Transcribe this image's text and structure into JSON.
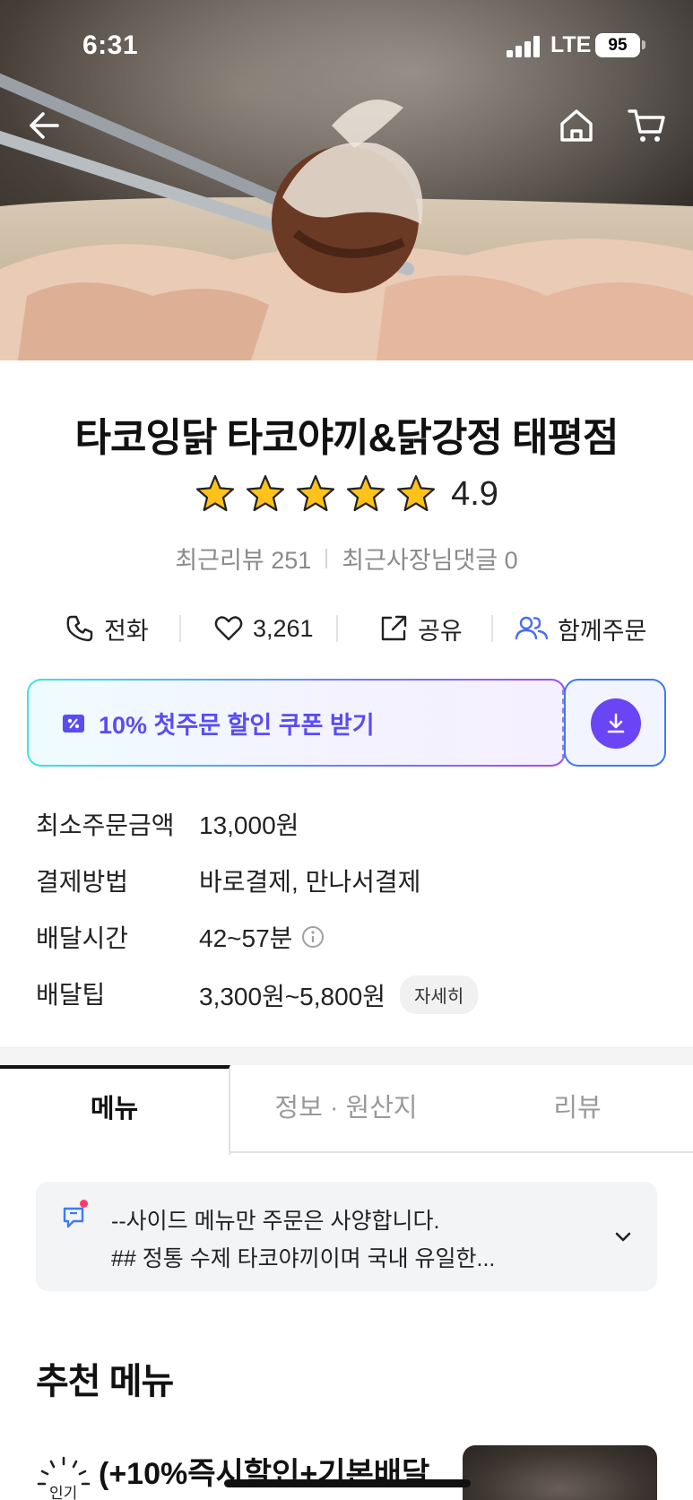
{
  "status_bar": {
    "time": "6:31",
    "network": "LTE",
    "battery": "95"
  },
  "hero": {
    "back_icon": "arrow-left-icon",
    "home_icon": "home-icon",
    "cart_icon": "cart-icon"
  },
  "store": {
    "name": "타코잉닭 타코야끼&닭강정 태평점",
    "rating": "4.9",
    "rating_stars": 5,
    "recent_reviews_label": "최근리뷰 251",
    "recent_owner_replies_label": "최근사장님댓글 0"
  },
  "actions": {
    "call_label": "전화",
    "like_count": "3,261",
    "share_label": "공유",
    "group_order_label": "함께주문"
  },
  "coupon": {
    "label": "10% 첫주문 할인 쿠폰 받기",
    "accent": "#5a4df0"
  },
  "info": [
    {
      "key": "최소주문금액",
      "value": "13,000원"
    },
    {
      "key": "결제방법",
      "value": "바로결제, 만나서결제"
    },
    {
      "key": "배달시간",
      "value": "42~57분"
    },
    {
      "key": "배달팁",
      "value": "3,300원~5,800원",
      "chip": "자세히"
    }
  ],
  "tabs": [
    {
      "label": "메뉴",
      "active": true
    },
    {
      "label": "정보 · 원산지",
      "active": false
    },
    {
      "label": "리뷰",
      "active": false
    }
  ],
  "notice": {
    "line1": "--사이드 메뉴만 주문은 사양합니다.",
    "line2": "## 정통 수제 타코야끼이며 국내 유일한..."
  },
  "recommended": {
    "title": "추천 메뉴",
    "first_item": {
      "badge": "인기",
      "title": "(+10%즉시할인+기본배달"
    }
  }
}
